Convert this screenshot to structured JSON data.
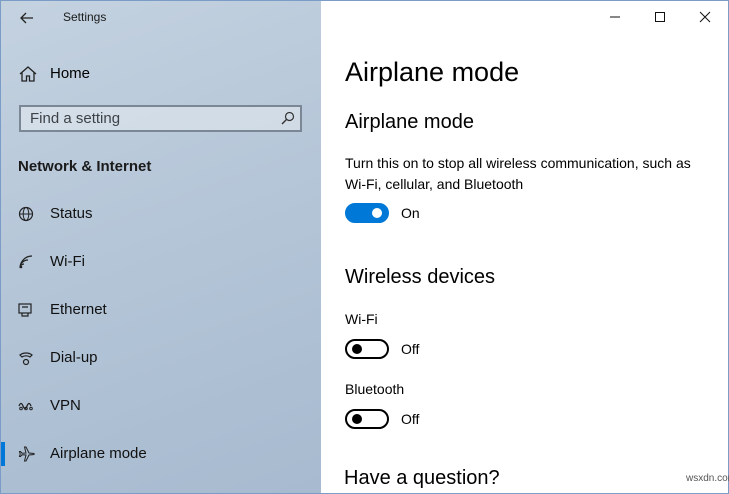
{
  "window": {
    "app_title": "Settings",
    "controls": {
      "minimize": "minimize-icon",
      "maximize": "maximize-icon",
      "close": "close-icon"
    }
  },
  "sidebar": {
    "home_label": "Home",
    "search": {
      "placeholder": "Find a setting",
      "value": ""
    },
    "section_title": "Network & Internet",
    "items": [
      {
        "label": "Status",
        "icon": "globe-icon",
        "selected": false
      },
      {
        "label": "Wi-Fi",
        "icon": "wifi-icon",
        "selected": false
      },
      {
        "label": "Ethernet",
        "icon": "ethernet-icon",
        "selected": false
      },
      {
        "label": "Dial-up",
        "icon": "dialup-icon",
        "selected": false
      },
      {
        "label": "VPN",
        "icon": "vpn-icon",
        "selected": false
      },
      {
        "label": "Airplane mode",
        "icon": "airplane-icon",
        "selected": true
      }
    ],
    "accent_color": "#0078d7"
  },
  "main": {
    "page_title": "Airplane mode",
    "airplane": {
      "heading": "Airplane mode",
      "description": "Turn this on to stop all wireless communication, such as Wi-Fi, cellular, and Bluetooth",
      "toggle_state": "On",
      "toggle_on": true
    },
    "wireless": {
      "heading": "Wireless devices",
      "wifi_label": "Wi-Fi",
      "wifi_state": "Off",
      "bluetooth_label": "Bluetooth",
      "bluetooth_state": "Off"
    },
    "question": "Have a question?"
  },
  "watermark": "wsxdn.com"
}
